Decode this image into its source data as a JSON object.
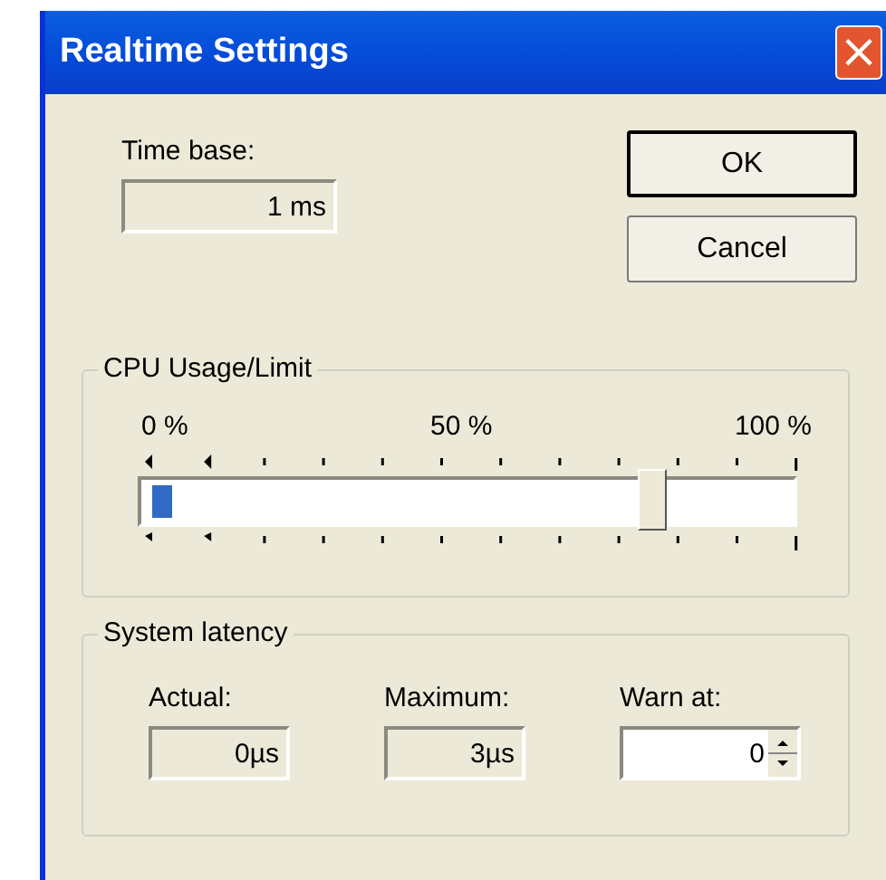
{
  "window": {
    "title": "Realtime Settings",
    "close": "×"
  },
  "time_base": {
    "label": "Time base:",
    "value": "1 ms"
  },
  "buttons": [
    {
      "label": "OK",
      "default": true
    },
    {
      "label": "Cancel",
      "default": false
    }
  ],
  "cpu": {
    "title": "CPU Usage/Limit",
    "scale": [
      "0 %",
      "50 %",
      "100 %"
    ],
    "usage": {
      "level": 0.03
    },
    "limit": {
      "level": 0.8
    }
  },
  "latency": {
    "title": "System latency",
    "fields": [
      {
        "kind": "readout",
        "label": "Actual:",
        "value": "0µs"
      },
      {
        "kind": "readout",
        "label": "Maximum:",
        "value": "3µs"
      },
      {
        "kind": "spin",
        "label": "Warn at:",
        "value": "0"
      }
    ]
  }
}
